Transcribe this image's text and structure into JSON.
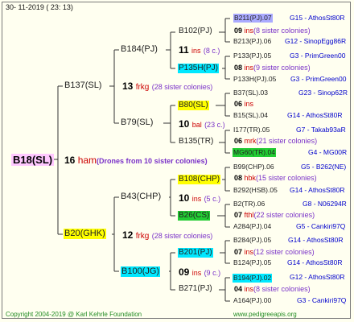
{
  "header": {
    "date": "30- 11-2019 ( 23: 13)"
  },
  "footer": {
    "copyright": "Copyright 2004-2019 @ Karl Kehrle Foundation",
    "website": "www.pedigreeapis.org"
  },
  "colors": {
    "yellow": "#ffff00",
    "cyan": "#00e8ff",
    "green": "#22cc33",
    "purple": "#aaaaff",
    "root": "#ffc8ff",
    "ins_red": "#cc0000",
    "sister_purple": "#7a32c8",
    "source_blue": "#0000cc",
    "footer_green": "#228b22"
  },
  "pedigree": {
    "root": "B18(SL)",
    "root_info": {
      "num": "16",
      "ins": "ham",
      "note": "(Drones from 10 sister colonies)"
    },
    "g1": [
      {
        "name": "B137(SL)",
        "num": "13",
        "ins": "frkg",
        "note": "(28 sister colonies)"
      },
      {
        "name": "B20(GHK)",
        "num": "12",
        "ins": "frkg",
        "note": "(28 sister colonies)"
      }
    ],
    "g2": [
      {
        "name": "B184(PJ)",
        "num": "11",
        "ins": "ins",
        "note": "(8 c.)"
      },
      {
        "name": "B79(SL)",
        "num": "10",
        "ins": "bal",
        "note": "(23 c.)"
      },
      {
        "name": "B43(CHP)",
        "num": "10",
        "ins": "ins",
        "note": "(5 c.)"
      },
      {
        "name": "B100(JG)",
        "num": "09",
        "ins": "ins",
        "note": "(9 c.)"
      }
    ],
    "g3": [
      {
        "name": "B102(PJ)",
        "num": "09",
        "ins": "ins",
        "note": "(8 sister colonies)"
      },
      {
        "name": "P135H(PJ)",
        "num": "08",
        "ins": "ins",
        "note": "(9 sister colonies)"
      },
      {
        "name": "B80(SL)",
        "num": "06",
        "ins": "ins",
        "note": ""
      },
      {
        "name": "B135(TR)",
        "num": "06",
        "ins": "mrk",
        "note": "(21 sister colonies)"
      },
      {
        "name": "B108(CHP)",
        "num": "08",
        "ins": "hbk",
        "note": "(15 sister colonies)"
      },
      {
        "name": "B26(CS)",
        "num": "07",
        "ins": "fthl",
        "note": "(22 sister colonies)"
      },
      {
        "name": "B201(PJ)",
        "num": "07",
        "ins": "ins",
        "note": "(12 sister colonies)"
      },
      {
        "name": "B271(PJ)",
        "num": "04",
        "ins": "ins",
        "note": "(8 sister colonies)"
      }
    ],
    "g4": [
      {
        "name": "B211(PJ).07",
        "src": "G15 - AthosSt80R"
      },
      {
        "name": "B213(PJ).06",
        "src": "G12 - SinopEgg86R"
      },
      {
        "name": "P133(PJ).05",
        "src": "G3 - PrimGreen00"
      },
      {
        "name": "P133H(PJ).05",
        "src": "G3 - PrimGreen00"
      },
      {
        "name": "B37(SL).03",
        "src": "G23 - Sinop62R"
      },
      {
        "name": "B15(SL).04",
        "src": "G14 - AthosSt80R"
      },
      {
        "name": "I177(TR).05",
        "src": "G7 - Takab93aR"
      },
      {
        "name": "MG60(TR).04",
        "src": "G4 - MG00R"
      },
      {
        "name": "B99(CHP).06",
        "src": "G5 - B262(NE)"
      },
      {
        "name": "B292(HSB).05",
        "src": "G14 - AthosSt80R"
      },
      {
        "name": "B2(TR).06",
        "src": "G8 - N06294R"
      },
      {
        "name": "A284(PJ).04",
        "src": "G5 - Cankiri97Q"
      },
      {
        "name": "B284(PJ).05",
        "src": "G14 - AthosSt80R"
      },
      {
        "name": "B124(PJ).05",
        "src": "G14 - AthosSt80R"
      },
      {
        "name": "B194(PJ).02",
        "src": "G12 - AthosSt80R"
      },
      {
        "name": "A164(PJ).00",
        "src": "G3 - Cankiri97Q"
      }
    ]
  }
}
